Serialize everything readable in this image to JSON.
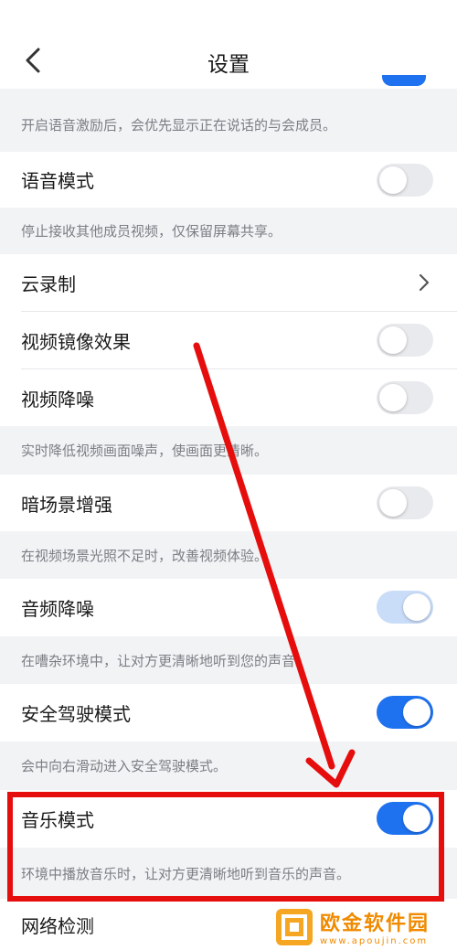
{
  "header": {
    "title": "设置"
  },
  "items": [
    {
      "type": "desc",
      "text": "开启语音激励后，会优先显示正在说话的与会成员。"
    },
    {
      "type": "row",
      "label": "语音模式",
      "control": "toggle",
      "state": "off"
    },
    {
      "type": "desc",
      "text": "停止接收其他成员视频，仅保留屏幕共享。"
    },
    {
      "type": "row",
      "label": "云录制",
      "control": "chevron"
    },
    {
      "type": "row",
      "label": "视频镜像效果",
      "control": "toggle",
      "state": "off"
    },
    {
      "type": "row",
      "label": "视频降噪",
      "control": "toggle",
      "state": "off"
    },
    {
      "type": "desc",
      "text": "实时降低视频画面噪声，使画面更清晰。"
    },
    {
      "type": "row",
      "label": "暗场景增强",
      "control": "toggle",
      "state": "off"
    },
    {
      "type": "desc",
      "text": "在视频场景光照不足时，改善视频体验。"
    },
    {
      "type": "row",
      "label": "音频降噪",
      "control": "toggle",
      "state": "on-disabled"
    },
    {
      "type": "desc",
      "text": "在嘈杂环境中，让对方更清晰地听到您的声音。"
    },
    {
      "type": "row",
      "label": "安全驾驶模式",
      "control": "toggle",
      "state": "on"
    },
    {
      "type": "desc",
      "text": "会中向右滑动进入安全驾驶模式。"
    },
    {
      "type": "row",
      "label": "音乐模式",
      "control": "toggle",
      "state": "on"
    },
    {
      "type": "desc",
      "text": "环境中播放音乐时，让对方更清晰地听到音乐的声音。"
    },
    {
      "type": "row",
      "label": "网络检测",
      "control": "none"
    }
  ],
  "watermark": {
    "title": "欧金软件园",
    "url": "www.apoujin.com"
  },
  "colors": {
    "accent": "#1e72f0",
    "annotation": "#e60d0d",
    "watermark": "#f08a00"
  }
}
